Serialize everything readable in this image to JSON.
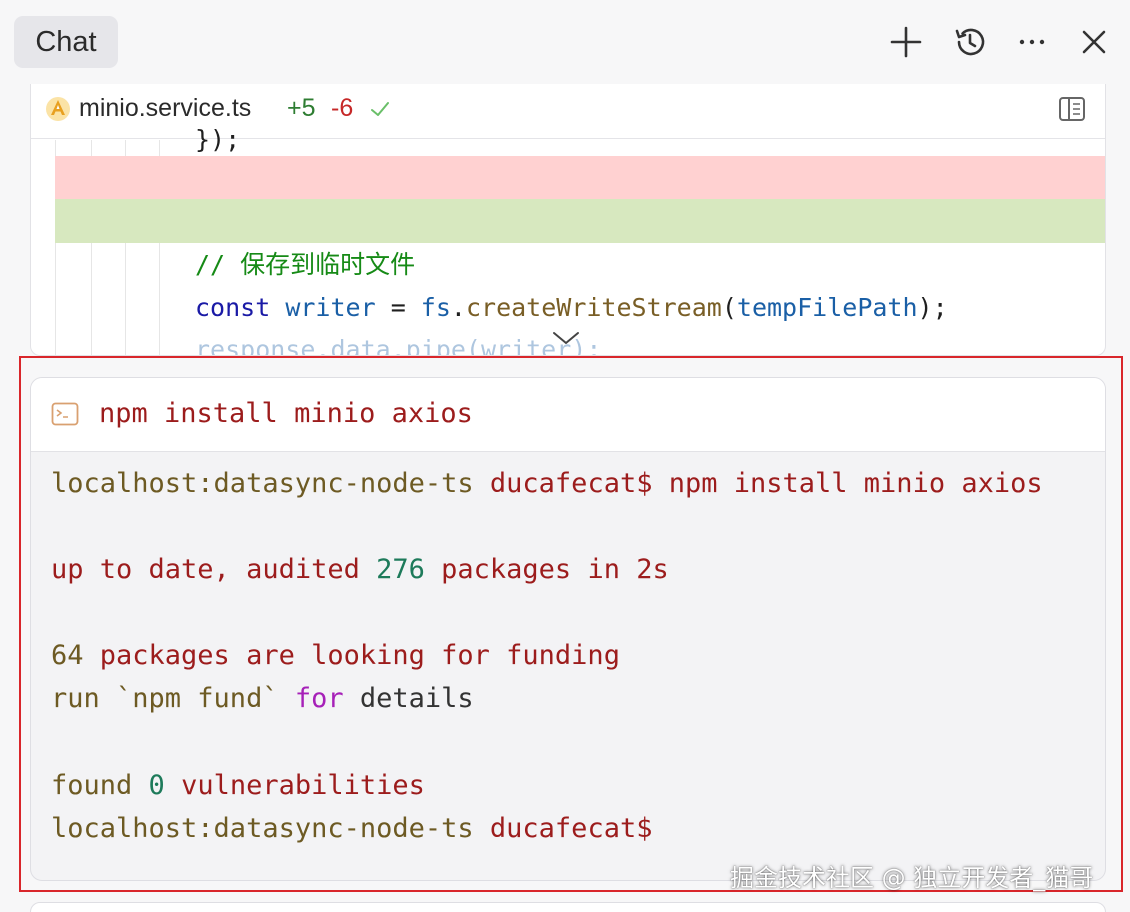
{
  "header": {
    "tab_label": "Chat",
    "icons": [
      "plus-icon",
      "history-icon",
      "more-icon",
      "close-icon"
    ]
  },
  "diff": {
    "file_name": "minio.service.ts",
    "additions": "+5",
    "deletions": "-6",
    "lines": {
      "top_partial": "});",
      "comment": "// 保存到临时文件",
      "kw_const": "const",
      "var_writer": "writer",
      "op_eq": " = ",
      "obj_fs": "fs",
      "dot": ".",
      "fn_create": "createWriteStream",
      "paren_open": "(",
      "arg_temp": "tempFilePath",
      "paren_close": ");",
      "faded": "response.data.pipe(writer);"
    }
  },
  "terminal": {
    "command": "npm install minio axios",
    "host": "localhost:datasync-node-ts",
    "user": "ducafecat$",
    "echo_cmd": "npm install minio axios",
    "l2_a": "up to date, audited ",
    "l2_num": "276",
    "l2_b": " packages in 2s",
    "l3_num": "64",
    "l3_b": " packages are looking for funding",
    "l4_a": "  run `npm fund` ",
    "l4_for": "for",
    "l4_b": " details",
    "l5_a": "found ",
    "l5_num": "0",
    "l5_b": " vulnerabilities"
  },
  "watermark": "掘金技术社区 @ 独立开发者_猫哥",
  "colors": {
    "highlight_frame": "#d9262b",
    "diff_deleted": "#ffd1d1",
    "diff_added": "#d7e8bf"
  }
}
